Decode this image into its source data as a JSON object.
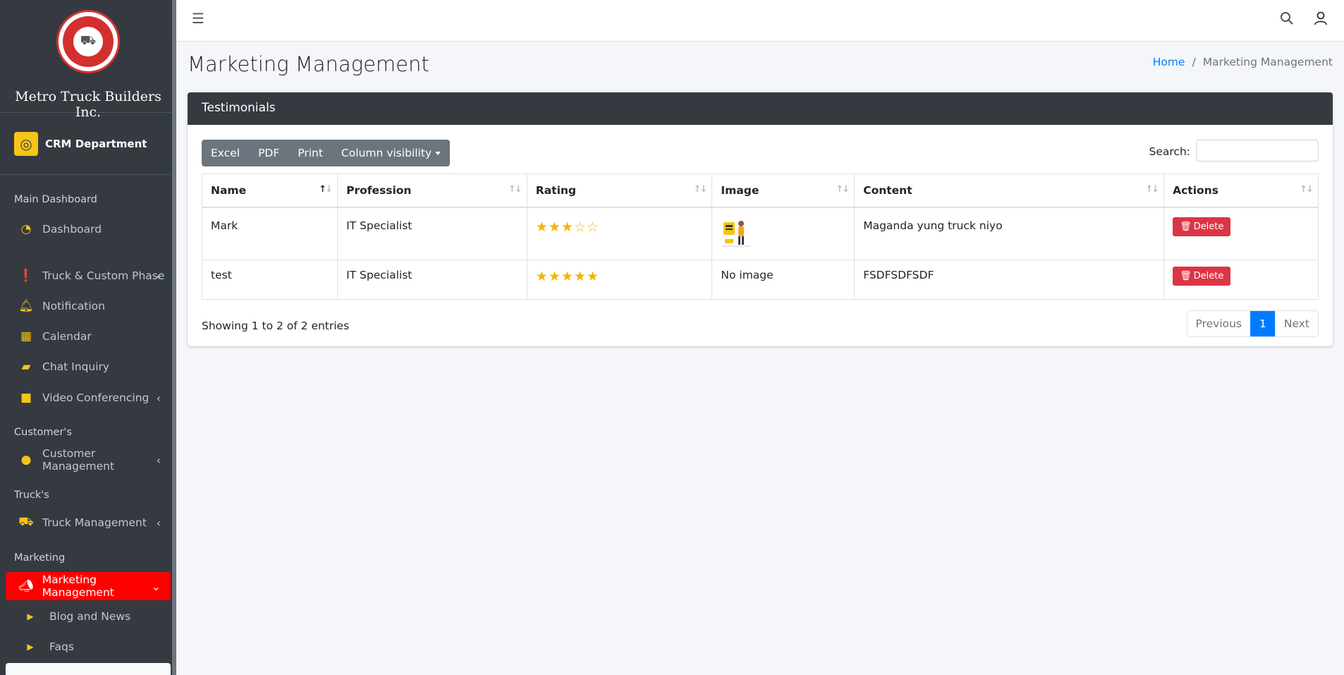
{
  "brand": {
    "name": "Metro Truck Builders Inc.",
    "logo_text": "METRO TRUCK Builders Inc."
  },
  "department": {
    "label": "CRM Department"
  },
  "sidebar": {
    "sections": [
      {
        "header": "Main Dashboard"
      },
      {
        "header": "Customer's"
      },
      {
        "header": "Truck's"
      },
      {
        "header": "Marketing"
      }
    ],
    "items": [
      {
        "label": "Dashboard",
        "icon": "dashboard-icon"
      },
      {
        "label": "Truck & Custom Phase",
        "icon": "alert-icon",
        "has_submenu": true
      },
      {
        "label": "Notification",
        "icon": "bell-icon"
      },
      {
        "label": "Calendar",
        "icon": "calendar-icon"
      },
      {
        "label": "Chat Inquiry",
        "icon": "chat-icon"
      },
      {
        "label": "Video Conferencing",
        "icon": "video-icon",
        "has_submenu": true
      },
      {
        "label": "Customer Management",
        "icon": "user-icon",
        "has_submenu": true
      },
      {
        "label": "Truck Management",
        "icon": "truck-icon",
        "has_submenu": true
      },
      {
        "label": "Marketing Management",
        "icon": "megaphone-icon",
        "has_submenu": true,
        "active": true
      },
      {
        "label": "Blog and News",
        "icon": "caret-right-icon"
      },
      {
        "label": "Faqs",
        "icon": "caret-right-icon"
      }
    ],
    "accent_color": "#f5c518",
    "active_color": "#ff0000"
  },
  "page": {
    "title": "Marketing Management",
    "breadcrumb": {
      "home": "Home",
      "current": "Marketing Management"
    }
  },
  "card": {
    "title": "Testimonials",
    "buttons": {
      "excel": "Excel",
      "pdf": "PDF",
      "print": "Print",
      "column_visibility": "Column visibility"
    },
    "search": {
      "label": "Search:",
      "value": ""
    },
    "table": {
      "columns": [
        "Name",
        "Profession",
        "Rating",
        "Image",
        "Content",
        "Actions"
      ],
      "rows": [
        {
          "name": "Mark",
          "profession": "IT Specialist",
          "rating": 3,
          "rating_stars": "★★★☆☆",
          "image": "",
          "content": "Maganda yung truck niyo",
          "action": "Delete"
        },
        {
          "name": "test",
          "profession": "IT Specialist",
          "rating": 5,
          "rating_stars": "★★★★★",
          "image": "No image",
          "content": "FSDFSDFSDF",
          "action": "Delete"
        }
      ]
    },
    "info": "Showing 1 to 2 of 2 entries",
    "pagination": {
      "previous": "Previous",
      "current": "1",
      "next": "Next"
    }
  }
}
